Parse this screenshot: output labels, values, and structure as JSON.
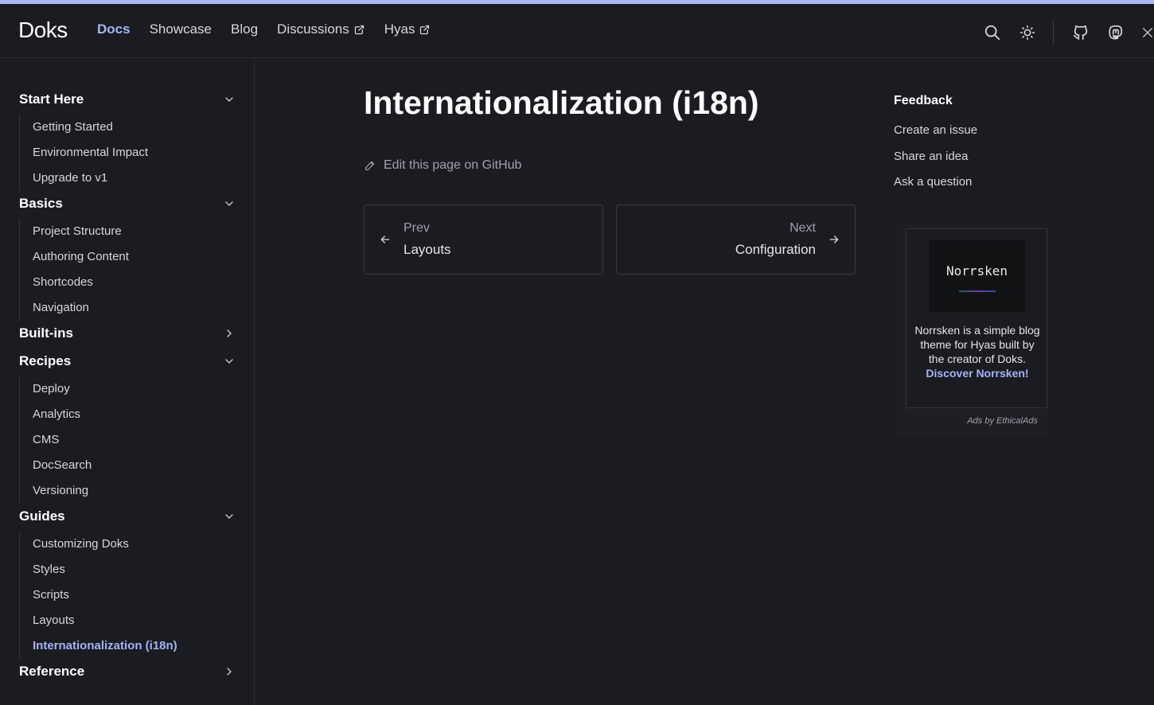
{
  "header": {
    "logo": "Doks",
    "nav": [
      {
        "label": "Docs",
        "active": true,
        "external": false
      },
      {
        "label": "Showcase",
        "active": false,
        "external": false
      },
      {
        "label": "Blog",
        "active": false,
        "external": false
      },
      {
        "label": "Discussions",
        "active": false,
        "external": true
      },
      {
        "label": "Hyas",
        "active": false,
        "external": true
      }
    ],
    "icons": [
      "search-icon",
      "sun-icon",
      "github-icon",
      "mastodon-icon",
      "x-icon"
    ]
  },
  "sidebar": {
    "sections": [
      {
        "title": "Start Here",
        "expanded": true,
        "items": [
          "Getting Started",
          "Environmental Impact",
          "Upgrade to v1"
        ]
      },
      {
        "title": "Basics",
        "expanded": true,
        "items": [
          "Project Structure",
          "Authoring Content",
          "Shortcodes",
          "Navigation"
        ]
      },
      {
        "title": "Built-ins",
        "expanded": false,
        "items": []
      },
      {
        "title": "Recipes",
        "expanded": true,
        "items": [
          "Deploy",
          "Analytics",
          "CMS",
          "DocSearch",
          "Versioning"
        ]
      },
      {
        "title": "Guides",
        "expanded": true,
        "items": [
          "Customizing Doks",
          "Styles",
          "Scripts",
          "Layouts",
          "Internationalization (i18n)"
        ]
      },
      {
        "title": "Reference",
        "expanded": false,
        "items": []
      }
    ],
    "active_item": "Internationalization (i18n)"
  },
  "main": {
    "title": "Internationalization (i18n)",
    "edit_link": "Edit this page on GitHub",
    "prev": {
      "label": "Prev",
      "title": "Layouts"
    },
    "next": {
      "label": "Next",
      "title": "Configuration"
    }
  },
  "toc": {
    "title": "Feedback",
    "links": [
      "Create an issue",
      "Share an idea",
      "Ask a question"
    ]
  },
  "ad": {
    "image_text": "Norrsken",
    "text": "Norrsken is a simple blog theme for Hyas built by the creator of Doks.",
    "cta": "Discover Norrsken!",
    "by": "Ads by EthicalAds"
  },
  "colors": {
    "background": "#1b1c21",
    "accent": "#a3b4f7",
    "top_stripe": "#a8b8f5"
  }
}
